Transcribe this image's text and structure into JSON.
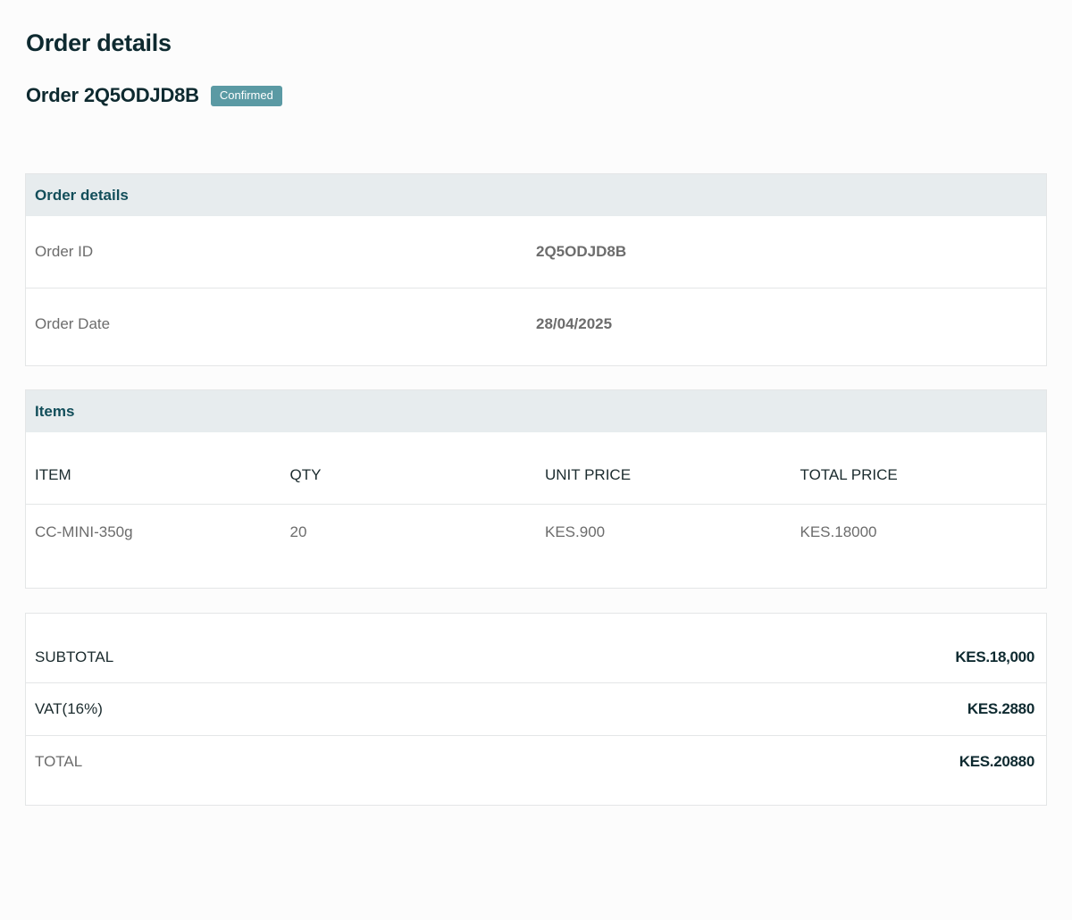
{
  "page": {
    "title": "Order details"
  },
  "order": {
    "heading": "Order 2Q5ODJD8B",
    "status": "Confirmed",
    "status_color": "#5b9aa4"
  },
  "details_card": {
    "header": "Order details",
    "rows": [
      {
        "label": "Order ID",
        "value": "2Q5ODJD8B"
      },
      {
        "label": "Order Date",
        "value": "28/04/2025"
      }
    ]
  },
  "items_card": {
    "header": "Items",
    "columns": [
      "ITEM",
      "QTY",
      "UNIT PRICE",
      "TOTAL PRICE"
    ],
    "rows": [
      {
        "item": "CC-MINI-350g",
        "qty": "20",
        "unit_price": "KES.900",
        "total_price": "KES.18000"
      }
    ]
  },
  "summary": {
    "rows": [
      {
        "label": "SUBTOTAL",
        "value": "KES.18,000"
      },
      {
        "label": "VAT(16%)",
        "value": "KES.2880"
      },
      {
        "label": "TOTAL",
        "value": "KES.20880"
      }
    ]
  },
  "colors": {
    "heading_text": "#0e2a30",
    "section_header_bg": "#e7ecee",
    "section_header_text": "#124e5a",
    "muted_text": "#6c6c6c",
    "border": "#e4e6e7"
  }
}
